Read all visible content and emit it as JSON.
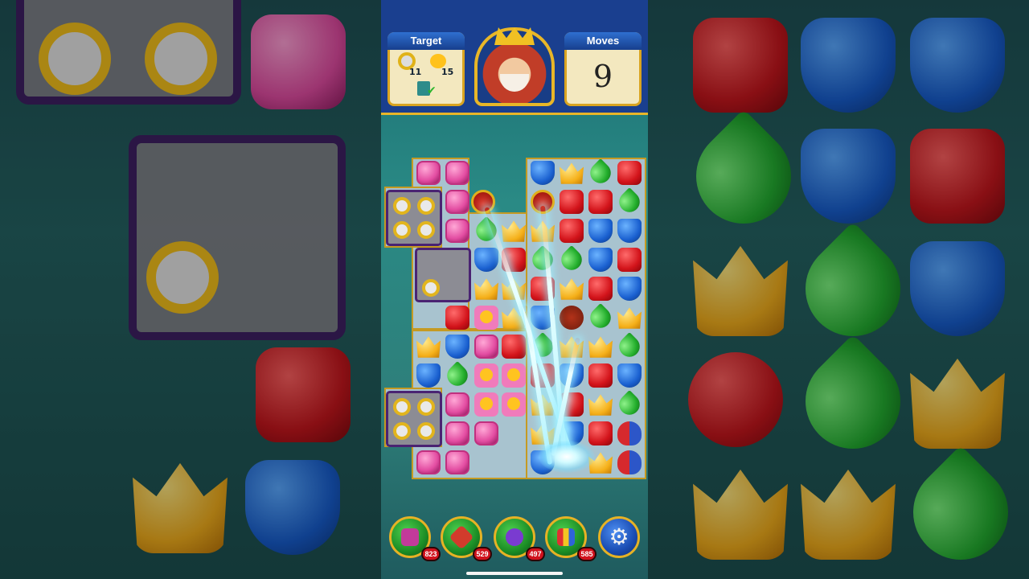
{
  "game": {
    "target_label": "Target",
    "moves_label": "Moves",
    "moves_value": "9",
    "targets": [
      {
        "name": "gold-ring",
        "count": "11"
      },
      {
        "name": "rubber-duck",
        "count": "15"
      },
      {
        "name": "book",
        "completed": true
      }
    ]
  },
  "boosters": [
    {
      "name": "hammer-icon",
      "count": "823"
    },
    {
      "name": "arrow-icon",
      "count": "529"
    },
    {
      "name": "cannon-icon",
      "count": "497"
    },
    {
      "name": "jester-hat-icon",
      "count": "585"
    }
  ],
  "settings_icon": "gear-icon",
  "colors": {
    "topbar": "#1a3f8f",
    "gold_trim": "#e8b628",
    "badge_red": "#d0121d"
  }
}
